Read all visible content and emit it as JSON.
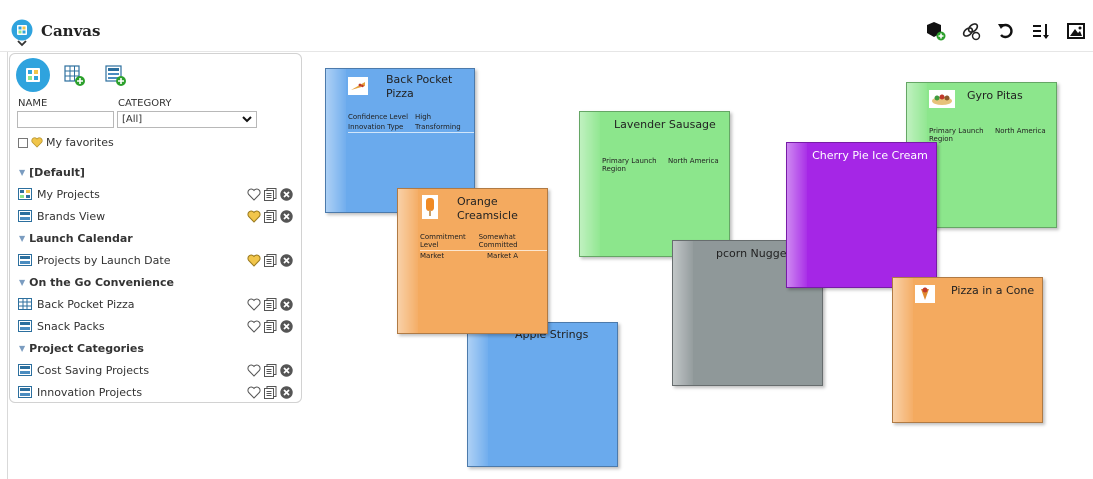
{
  "app": {
    "title": "Canvas"
  },
  "toolbar": {
    "items": [
      {
        "name": "add-hex-icon"
      },
      {
        "name": "link-settings-icon"
      },
      {
        "name": "refresh-icon"
      },
      {
        "name": "sort-icon"
      },
      {
        "name": "image-icon"
      }
    ]
  },
  "sidebar": {
    "name_label": "NAME",
    "name_value": "",
    "category_label": "CATEGORY",
    "category_value": "[All]",
    "favorites_label": "My favorites",
    "groups": [
      {
        "label": "[Default]",
        "items": [
          {
            "label": "My Projects",
            "favorite": false
          },
          {
            "label": "Brands View",
            "favorite": true
          }
        ]
      },
      {
        "label": "Launch Calendar",
        "items": [
          {
            "label": "Projects by Launch Date",
            "favorite": true
          }
        ]
      },
      {
        "label": "On the Go Convenience",
        "items": [
          {
            "label": "Back Pocket Pizza",
            "favorite": false
          },
          {
            "label": "Snack Packs",
            "favorite": false
          }
        ]
      },
      {
        "label": "Project Categories",
        "items": [
          {
            "label": "Cost Saving Projects",
            "favorite": false
          },
          {
            "label": "Innovation Projects",
            "favorite": false
          }
        ]
      }
    ]
  },
  "colors": {
    "accent": "#2fa3de",
    "blue": "#6aaaed",
    "orange": "#f4aa5f",
    "green": "#8ce68c",
    "purple": "#a526e6",
    "gray": "#8f9899",
    "heart": "#f1c54a"
  },
  "cards": {
    "back_pocket_pizza": {
      "title": "Back Pocket Pizza",
      "fields": [
        {
          "k": "Confidence Level",
          "v": "High"
        },
        {
          "k": "Innovation Type",
          "v": "Transforming"
        }
      ]
    },
    "orange_creamsicle": {
      "title": "Orange Creamsicle",
      "fields": [
        {
          "k": "Commitment Level",
          "v": "Somewhat Committed"
        },
        {
          "k": "Market",
          "v": "Market A"
        }
      ]
    },
    "apple_strings": {
      "title": "Apple Strings"
    },
    "lavender_sausage": {
      "title": "Lavender Sausage",
      "fields": [
        {
          "k": "Primary Launch Region",
          "v": "North America"
        }
      ]
    },
    "popcorn_nuggets": {
      "title": "pcorn Nuggets"
    },
    "cherry_pie": {
      "title": "Cherry Pie Ice Cream"
    },
    "gyro_pitas": {
      "title": "Gyro Pitas",
      "fields": [
        {
          "k": "Primary Launch Region",
          "v": "North America"
        }
      ]
    },
    "pizza_cone": {
      "title": "Pizza in a Cone"
    }
  }
}
